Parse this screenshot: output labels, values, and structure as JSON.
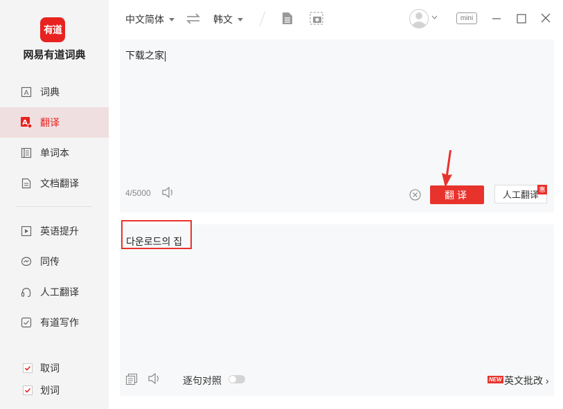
{
  "app": {
    "logo_text": "有道",
    "name": "网易有道词典"
  },
  "sidebar": {
    "items": [
      {
        "label": "词典",
        "icon": "dictionary-icon"
      },
      {
        "label": "翻译",
        "icon": "translate-icon",
        "active": true
      },
      {
        "label": "单词本",
        "icon": "wordbook-icon"
      },
      {
        "label": "文档翻译",
        "icon": "document-icon"
      },
      {
        "label": "英语提升",
        "icon": "play-icon"
      },
      {
        "label": "同传",
        "icon": "interpretation-icon"
      },
      {
        "label": "人工翻译",
        "icon": "headset-icon"
      },
      {
        "label": "有道写作",
        "icon": "writing-icon"
      }
    ],
    "checks": [
      {
        "label": "取词",
        "checked": true
      },
      {
        "label": "划词",
        "checked": true
      }
    ]
  },
  "toolbar": {
    "source_lang": "中文简体",
    "target_lang": "韩文",
    "mini_label": "mini"
  },
  "input": {
    "text": "下载之家",
    "char_count": "4/5000",
    "translate_label": "翻译",
    "human_translate_label": "人工翻译",
    "human_badge": "惠"
  },
  "output": {
    "text": "다운로드의 집",
    "sentence_compare_label": "逐句对照",
    "new_badge": "NEW",
    "essay_label": "英文批改 ›"
  },
  "colors": {
    "accent": "#e8332d",
    "active_bg": "#f0dfe0",
    "sidebar_bg": "#f4f4f5",
    "panel_bg": "#f7f8f9"
  }
}
